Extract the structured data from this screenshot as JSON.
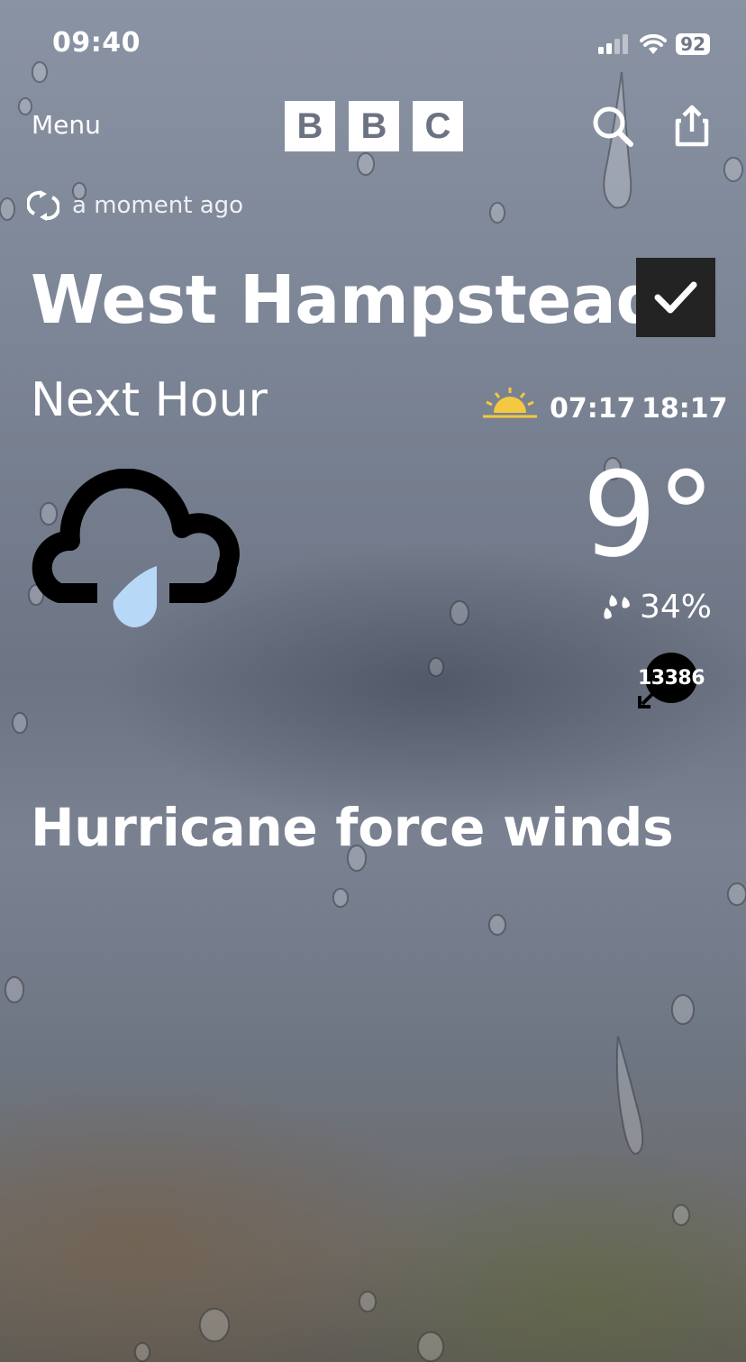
{
  "status_bar": {
    "time": "09:40",
    "battery": "92",
    "signal_icon": "cellular-signal-icon",
    "wifi_icon": "wifi-icon"
  },
  "header": {
    "menu_label": "Menu",
    "logo_letters": [
      "B",
      "B",
      "C"
    ],
    "search_icon": "search-icon",
    "share_icon": "share-icon"
  },
  "update": {
    "refresh_icon": "refresh-icon",
    "text": "a moment ago"
  },
  "location": {
    "name": "West Hampstead",
    "saved_icon": "checkmark-icon"
  },
  "forecast": {
    "period": "Next Hour",
    "sunrise": "07:17",
    "sunset": "18:17",
    "weather_icon": "light-rain-cloud-icon",
    "temperature": "9°",
    "precipitation": "34%",
    "wind_speed": "13386",
    "description": "Hurricane force winds"
  },
  "colors": {
    "sun_yellow": "#f5c842",
    "rain_drop": "#b8d8f8",
    "badge_dark": "#232323"
  }
}
